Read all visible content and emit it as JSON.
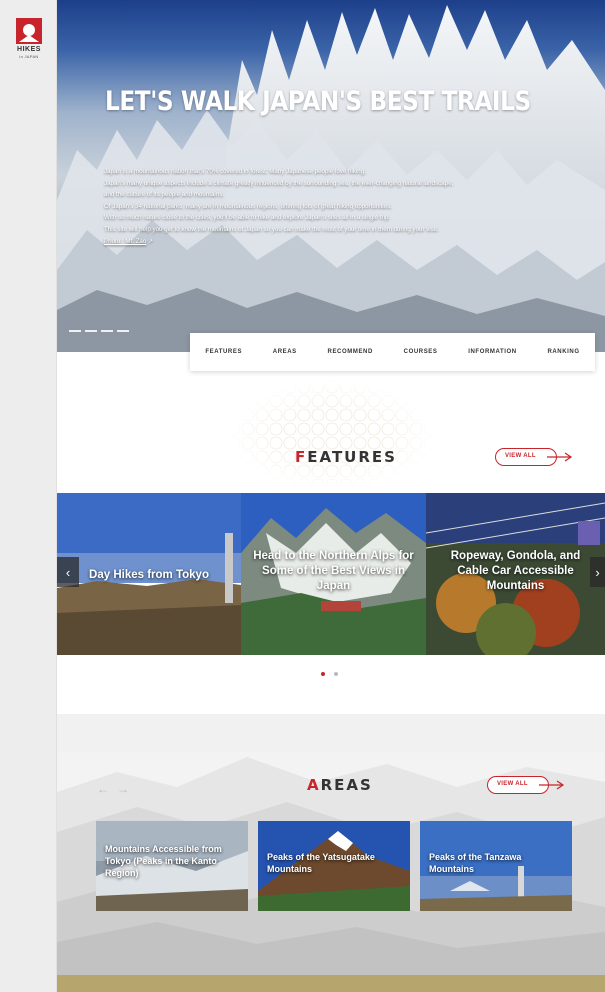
{
  "brand": {
    "logo_text": "HIKES",
    "logo_sub": "in JAPAN"
  },
  "hero": {
    "title": "LET'S WALK JAPAN'S BEST TRAILS",
    "paragraphs": [
      "Japan is a mountainous nation that's 70% covered in forest. Many Japanese people love hiking.",
      "Japan's many unique aspects include a climate greatly influenced by the surrounding sea, the ever-changing natural landscape,",
      "and the culture of its people and mountains.",
      "Of Japan's 34 national parks, many are in mountainous regions, offering lots of great hiking opportunities.",
      "With so much nature close to the cities, you'll be able to hike and explore Japan's sites all in a single trip.",
      "This site will help you get to know the mountains of Japan so you can make the most of your time in them during your visit."
    ],
    "credit": "Photo : Mt. Zao"
  },
  "nav": {
    "items": [
      "FEATURES",
      "AREAS",
      "RECOMMEND",
      "COURSES",
      "INFORMATION",
      "RANKING"
    ]
  },
  "features": {
    "title_first": "F",
    "title_rest": "EATURES",
    "view_all": "VIEW ALL",
    "cards": [
      {
        "caption": "Day Hikes from Tokyo"
      },
      {
        "caption": "Head to the Northern Alps for Some of the Best Views in Japan"
      },
      {
        "caption": "Ropeway, Gondola, and Cable Car Accessible Mountains"
      }
    ],
    "prev_arrow": "‹",
    "next_arrow": "›"
  },
  "areas": {
    "title_first": "A",
    "title_rest": "REAS",
    "view_all": "VIEW ALL",
    "prev_arrow": "←",
    "next_arrow": "→",
    "cards": [
      {
        "caption": "Mountains Accessible from Tokyo (Peaks in the Kanto Region)"
      },
      {
        "caption": "Peaks of the Yatsugatake Mountains"
      },
      {
        "caption": "Peaks of the Tanzawa Mountains"
      }
    ]
  },
  "colors": {
    "accent": "#c8242b",
    "text": "#333333"
  }
}
